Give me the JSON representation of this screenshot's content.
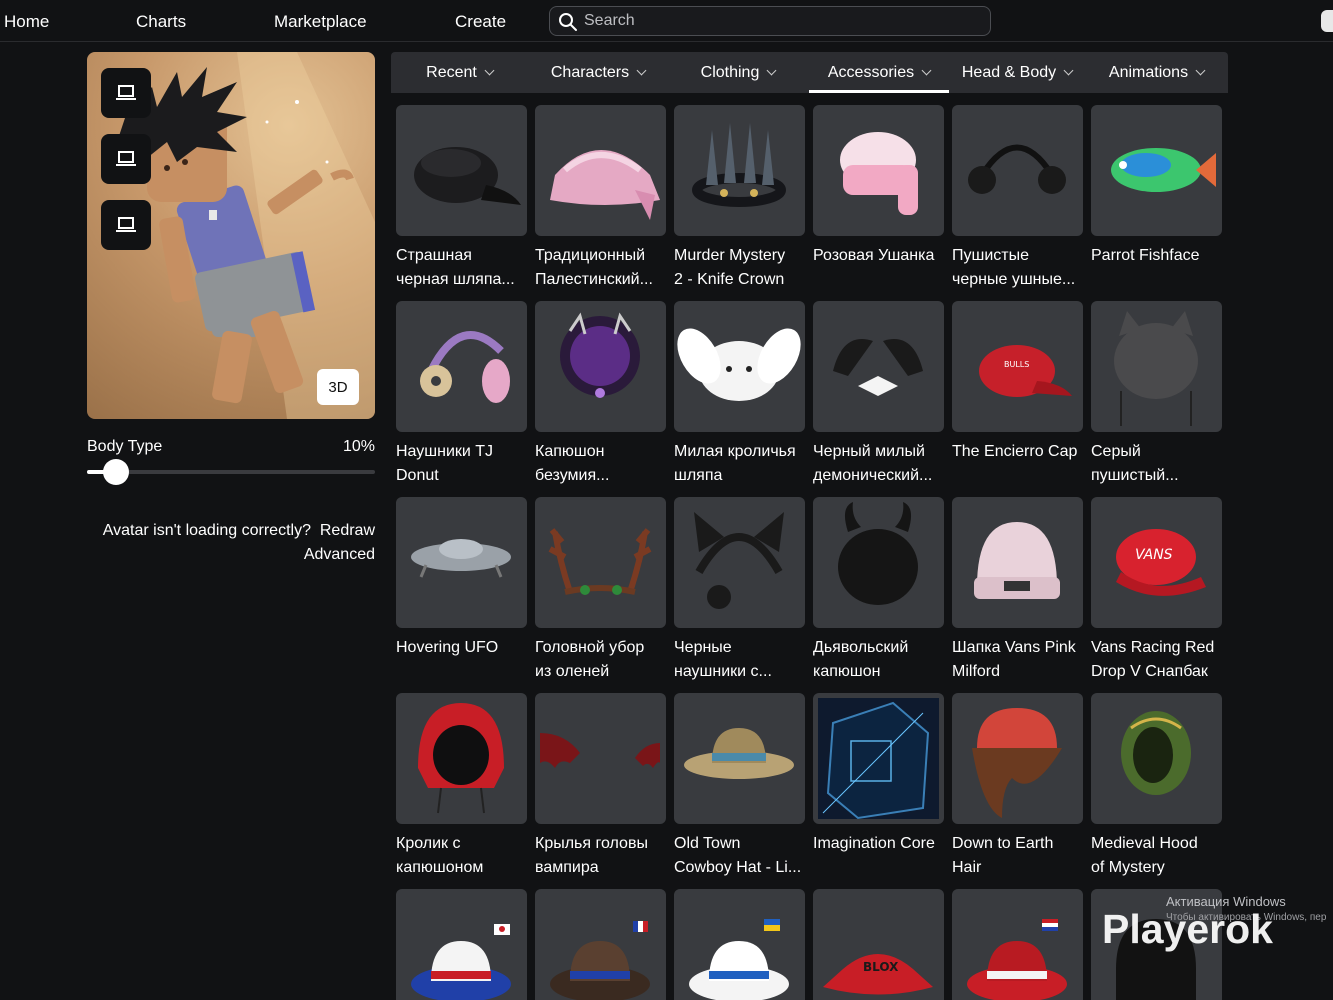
{
  "nav": {
    "home": "Home",
    "charts": "Charts",
    "marketplace": "Marketplace",
    "create": "Create",
    "search_placeholder": "Search"
  },
  "avatar": {
    "tool_icons": [
      "laptop-icon",
      "laptop-icon",
      "laptop-icon"
    ],
    "btn_3d": "3D",
    "body_type_label": "Body Type",
    "body_type_value": "10%",
    "body_type_fraction": 0.1,
    "loading_question": "Avatar isn't loading correctly?",
    "redraw": "Redraw",
    "advanced": "Advanced"
  },
  "tabs": [
    {
      "label": "Recent",
      "active": false
    },
    {
      "label": "Characters",
      "active": false
    },
    {
      "label": "Clothing",
      "active": false
    },
    {
      "label": "Accessories",
      "active": true
    },
    {
      "label": "Head & Body",
      "active": false
    },
    {
      "label": "Animations",
      "active": false
    }
  ],
  "items": [
    {
      "name1": "Страшная",
      "name2": "черная шляпа...",
      "icon": "black-cap"
    },
    {
      "name1": "Традиционный",
      "name2": "Палестинский...",
      "icon": "pink-keffiyeh"
    },
    {
      "name1": "Murder Mystery",
      "name2": "2 - Knife Crown",
      "icon": "knife-crown"
    },
    {
      "name1": "Розовая Ушанка",
      "name2": "",
      "icon": "pink-ushanka"
    },
    {
      "name1": "Пушистые",
      "name2": "черные ушные...",
      "icon": "black-earmuffs"
    },
    {
      "name1": "Parrot Fishface",
      "name2": "",
      "icon": "parrot-fish"
    },
    {
      "name1": "Наушники TJ",
      "name2": "Donut",
      "icon": "donut-headphones"
    },
    {
      "name1": "Капюшон",
      "name2": "безумия...",
      "icon": "purple-hood"
    },
    {
      "name1": "Милая кроличья",
      "name2": "шляпа",
      "icon": "bunny-hat"
    },
    {
      "name1": "Черный милый",
      "name2": "демонический...",
      "icon": "demon-horns-bow"
    },
    {
      "name1": "The Encierro Cap",
      "name2": "",
      "icon": "red-cap"
    },
    {
      "name1": "Серый",
      "name2": "пушистый...",
      "icon": "gray-cat-hat"
    },
    {
      "name1": "Hovering UFO",
      "name2": "",
      "icon": "ufo"
    },
    {
      "name1": "Головной убор",
      "name2": "из оленей",
      "icon": "antlers"
    },
    {
      "name1": "Черные",
      "name2": "наушники с...",
      "icon": "cat-ear-headphones"
    },
    {
      "name1": "Дьявольский",
      "name2": "капюшон",
      "icon": "devil-hood"
    },
    {
      "name1": "Шапка Vans Pink",
      "name2": "Milford",
      "icon": "pink-beanie"
    },
    {
      "name1": "Vans Racing Red",
      "name2": "Drop V Снапбак",
      "icon": "vans-red-cap"
    },
    {
      "name1": "Кролик с",
      "name2": "капюшоном",
      "icon": "red-hood"
    },
    {
      "name1": "Крылья головы",
      "name2": "вампира",
      "icon": "vampire-wings"
    },
    {
      "name1": "Old Town",
      "name2": "Cowboy Hat - Li...",
      "icon": "cowboy-hat"
    },
    {
      "name1": "Imagination Core",
      "name2": "",
      "icon": "imagination-cube"
    },
    {
      "name1": "Down to Earth",
      "name2": "Hair",
      "icon": "brown-hair-beanie"
    },
    {
      "name1": "Medieval Hood",
      "name2": "of Mystery",
      "icon": "green-hood"
    },
    {
      "name1": "",
      "name2": "",
      "icon": "fedora-korea"
    },
    {
      "name1": "",
      "name2": "",
      "icon": "fedora-france"
    },
    {
      "name1": "",
      "name2": "",
      "icon": "fedora-ukraine"
    },
    {
      "name1": "",
      "name2": "",
      "icon": "roblox-visor"
    },
    {
      "name1": "",
      "name2": "",
      "icon": "fedora-red"
    },
    {
      "name1": "",
      "name2": "",
      "icon": "black-hair"
    }
  ],
  "watermark": {
    "activation_title": "Активация Windows",
    "activation_sub": "Чтобы активировать Windows, пер",
    "brand": "Playerok"
  }
}
